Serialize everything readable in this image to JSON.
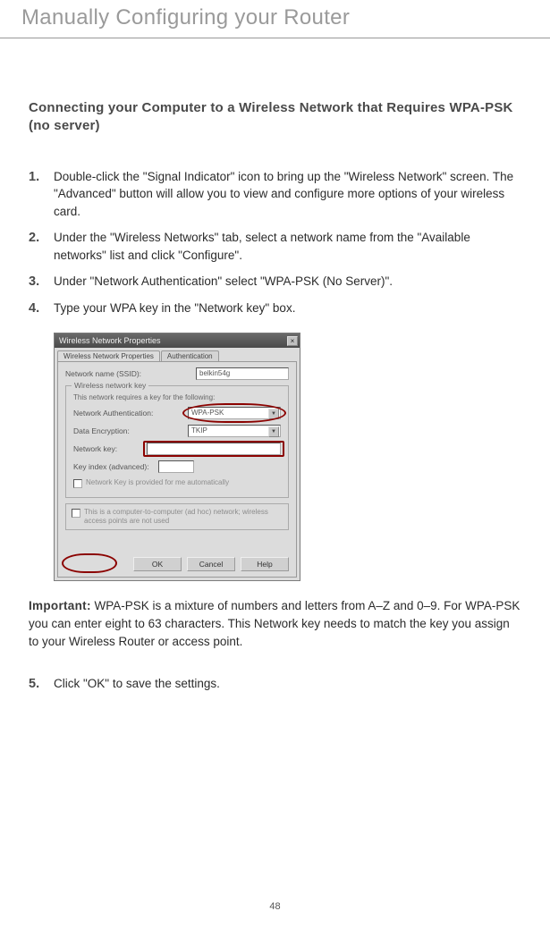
{
  "header": {
    "title": "Manually Configuring your Router"
  },
  "sub": {
    "title": "Connecting your Computer to a Wireless Network that Requires WPA-PSK (no server)"
  },
  "steps": {
    "n1": "1.",
    "t1": "Double-click the \"Signal Indicator\" icon to bring up the \"Wireless Network\" screen. The \"Advanced\" button will allow you to view and configure more options of your wireless card.",
    "n2": "2.",
    "t2": "Under the \"Wireless Networks\" tab, select a network name from the \"Available networks\" list and click \"Configure\".",
    "n3": "3.",
    "t3": "Under \"Network Authentication\" select \"WPA-PSK (No Server)\".",
    "n4": "4.",
    "t4": "Type your WPA key in the \"Network key\" box.",
    "n5": "5.",
    "t5": "Click \"OK\" to save the settings."
  },
  "dialog": {
    "title": "Wireless Network Properties",
    "tabs": {
      "prop": "Wireless Network Properties",
      "auth": "Authentication"
    },
    "labels": {
      "ssid": "Network name (SSID):",
      "group": "Wireless network key",
      "group_sub": "This network requires a key for the following:",
      "auth": "Network Authentication:",
      "enc": "Data Encryption:",
      "key": "Network key:",
      "index": "Key index (advanced):",
      "auto": "Network Key is provided for me automatically",
      "adhoc": "This is a computer-to-computer (ad hoc) network; wireless access points are not used"
    },
    "values": {
      "ssid": "belkin54g",
      "auth": "WPA-PSK",
      "enc": "TKIP"
    },
    "buttons": {
      "ok": "OK",
      "cancel": "Cancel",
      "help": "Help"
    }
  },
  "important": {
    "label": "Important:",
    "text": " WPA-PSK is a mixture of numbers and letters from A–Z and 0–9. For WPA-PSK you can enter eight to 63 characters. This Network key needs to match the key you assign to your Wireless Router or access point."
  },
  "page": {
    "num": "48"
  }
}
